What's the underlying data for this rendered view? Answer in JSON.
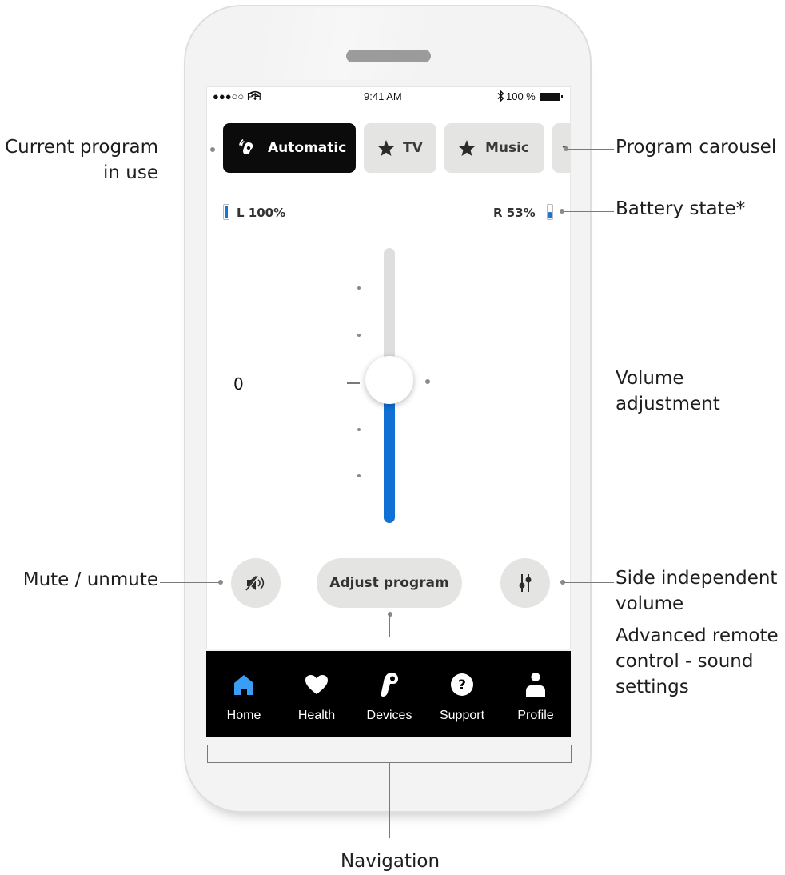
{
  "status_bar": {
    "carrier": "●●●○○ PH",
    "time": "9:41 AM",
    "battery": "100 %"
  },
  "programs": [
    {
      "label": "Automatic",
      "icon": "hearing-aid-icon",
      "active": true
    },
    {
      "label": "TV",
      "icon": "star-icon",
      "active": false
    },
    {
      "label": "Music",
      "icon": "star-icon",
      "active": false
    }
  ],
  "battery": {
    "left_label": "L 100%",
    "left_level": 1.0,
    "right_label": "R 53%",
    "right_level": 0.53
  },
  "volume": {
    "value": "0"
  },
  "controls": {
    "mute_icon": "speaker-mute-icon",
    "adjust_label": "Adjust program",
    "side_icon": "side-sliders-icon"
  },
  "nav": {
    "items": [
      {
        "label": "Home",
        "icon": "home-icon",
        "active": true
      },
      {
        "label": "Health",
        "icon": "heart-icon",
        "active": false
      },
      {
        "label": "Devices",
        "icon": "hearing-aid-icon",
        "active": false
      },
      {
        "label": "Support",
        "icon": "question-icon",
        "active": false
      },
      {
        "label": "Profile",
        "icon": "person-icon",
        "active": false
      }
    ]
  },
  "annotations": {
    "current_program_1": "Current program",
    "current_program_2": "in use",
    "program_carousel": "Program carousel",
    "battery_state": "Battery state*",
    "volume_1": "Volume",
    "volume_2": "adjustment",
    "mute": "Mute / unmute",
    "side_1": "Side independent",
    "side_2": "volume",
    "advanced_1": "Advanced remote",
    "advanced_2": "control - sound",
    "advanced_3": "settings",
    "navigation": "Navigation"
  },
  "colors": {
    "accent_blue": "#1070d6",
    "nav_active": "#3a9ef5",
    "active_program_bg": "#0b0b0b",
    "inactive_bg": "#e4e4e2"
  }
}
